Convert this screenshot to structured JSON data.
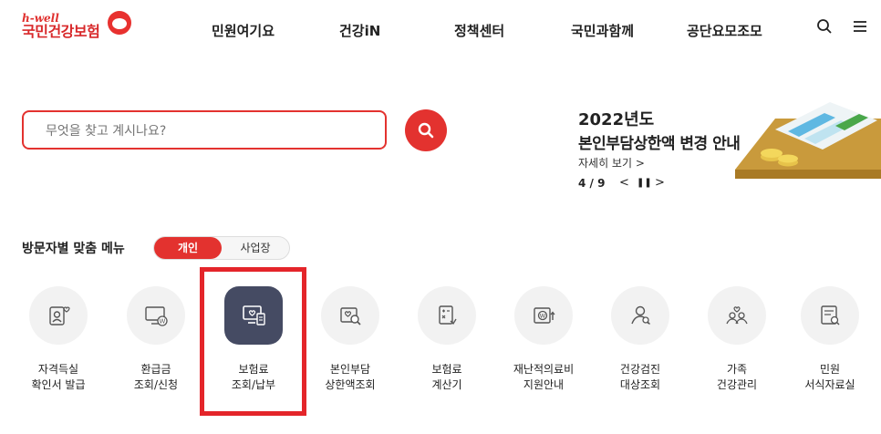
{
  "logo": {
    "tagline": "h-well",
    "name": "국민건강보험"
  },
  "nav": [
    "민원여기요",
    "건강iN",
    "정책센터",
    "국민과함께",
    "공단요모조모"
  ],
  "header_icons": [
    "search-icon",
    "menu-icon"
  ],
  "search": {
    "placeholder": "무엇을 찾고 계시나요?",
    "button_icon": "search-icon"
  },
  "banner": {
    "year": "2022년도",
    "title": "본인부담상한액 변경 안내",
    "more": "자세히 보기 >",
    "page": "4 / 9",
    "controls": [
      "<",
      "❚❚",
      ">"
    ]
  },
  "custom_menu": {
    "title": "방문자별 맞춤 메뉴",
    "toggle": {
      "selected": "개인",
      "other": "사업장"
    },
    "items": [
      {
        "line1": "자격득실",
        "line2": "확인서 발급",
        "icon": "certificate-icon"
      },
      {
        "line1": "환급금",
        "line2": "조회/신청",
        "icon": "refund-monitor-icon"
      },
      {
        "line1": "보험료",
        "line2": "조회/납부",
        "icon": "premium-payment-icon"
      },
      {
        "line1": "본인부담",
        "line2": "상한액조회",
        "icon": "search-card-icon"
      },
      {
        "line1": "보험료",
        "line2": "계산기",
        "icon": "calculator-icon"
      },
      {
        "line1": "재난적의료비",
        "line2": "지원안내",
        "icon": "wallet-icon"
      },
      {
        "line1": "건강검진",
        "line2": "대상조회",
        "icon": "people-search-icon"
      },
      {
        "line1": "가족",
        "line2": "건강관리",
        "icon": "family-icon"
      },
      {
        "line1": "민원",
        "line2": "서식자료실",
        "icon": "document-icon"
      }
    ]
  },
  "colors": {
    "brand": "#e3322f",
    "active_tile": "#454b63",
    "highlight_frame": "#e4252a"
  }
}
